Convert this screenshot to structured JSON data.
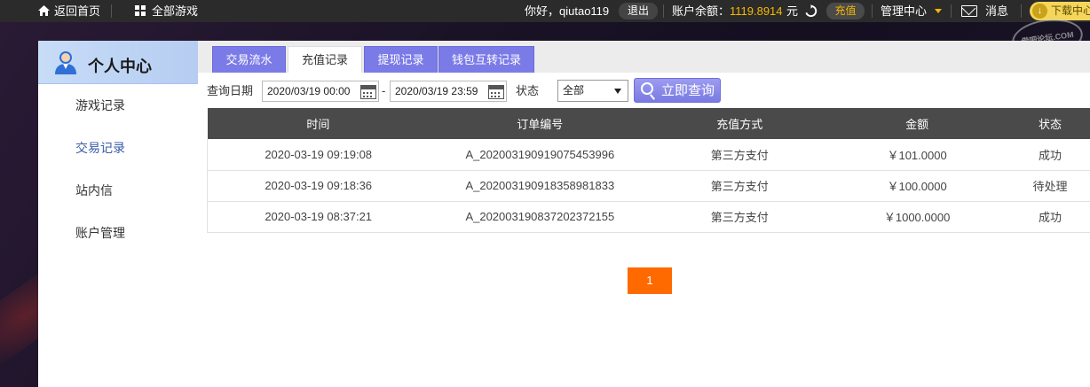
{
  "topbar": {
    "home_label": "返回首页",
    "games_label": "全部游戏",
    "greeting": "你好，qiutao119",
    "logout_label": "退出",
    "balance_label": "账户余额：",
    "balance_value": "1119.8914",
    "currency": "元",
    "recharge_label": "充值",
    "manage_label": "管理中心",
    "message_label": "消息",
    "download_label": "下载中心",
    "watermark_text": "借吧论坛.COM"
  },
  "sidebar": {
    "title": "个人中心",
    "items": [
      {
        "label": "游戏记录"
      },
      {
        "label": "交易记录"
      },
      {
        "label": "站内信"
      },
      {
        "label": "账户管理"
      }
    ]
  },
  "tabs": [
    {
      "label": "交易流水"
    },
    {
      "label": "充值记录"
    },
    {
      "label": "提现记录"
    },
    {
      "label": "钱包互转记录"
    }
  ],
  "filter": {
    "date_label": "查询日期",
    "start_date": "2020/03/19 00:00",
    "dash": "-",
    "end_date": "2020/03/19 23:59",
    "status_label": "状态",
    "status_value": "全部",
    "query_label": "立即查询"
  },
  "table": {
    "headers": [
      "时间",
      "订单编号",
      "充值方式",
      "金额",
      "状态"
    ],
    "rows": [
      [
        "2020-03-19 09:19:08",
        "A_202003190919075453996",
        "第三方支付",
        "￥101.0000",
        "成功"
      ],
      [
        "2020-03-19 09:18:36",
        "A_202003190918358981833",
        "第三方支付",
        "￥100.0000",
        "待处理"
      ],
      [
        "2020-03-19 08:37:21",
        "A_202003190837202372155",
        "第三方支付",
        "￥1000.0000",
        "成功"
      ]
    ]
  },
  "pagination": {
    "current_page": "1"
  },
  "colors": {
    "accent": "#7b7be8",
    "balance": "#f5b800",
    "page_button": "#ff6a00"
  }
}
